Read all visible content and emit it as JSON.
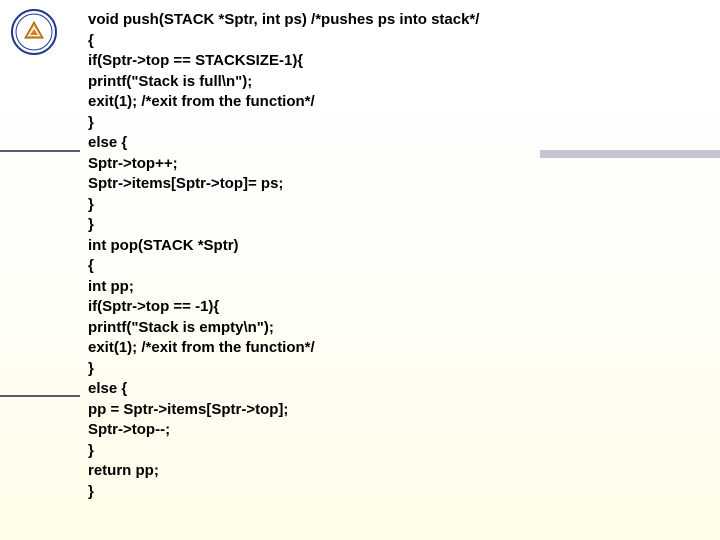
{
  "code_lines": [
    "void push(STACK *Sptr, int ps) /*pushes ps into stack*/",
    "{",
    "if(Sptr->top == STACKSIZE-1){",
    "printf(\"Stack is full\\n\");",
    "exit(1); /*exit from the function*/",
    "}",
    "else {",
    "Sptr->top++;",
    "Sptr->items[Sptr->top]= ps;",
    "}",
    "}",
    "int pop(STACK *Sptr)",
    "{",
    "int pp;",
    "if(Sptr->top == -1){",
    "printf(\"Stack is empty\\n\");",
    "exit(1); /*exit from the function*/",
    "}",
    "else {",
    "pp = Sptr->items[Sptr->top];",
    "Sptr->top--;",
    "}",
    "return pp;",
    "}"
  ]
}
